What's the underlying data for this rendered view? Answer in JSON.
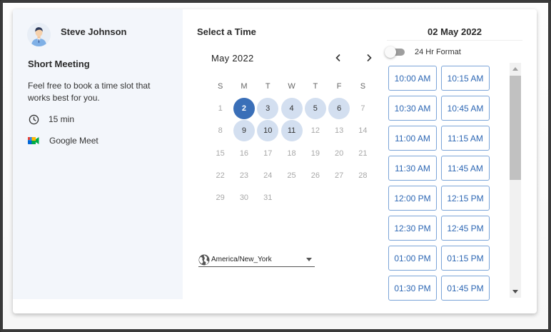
{
  "host": {
    "name": "Steve Johnson",
    "avatar_icon": "user-avatar-icon"
  },
  "event": {
    "title": "Short Meeting",
    "description": "Feel free to book a time slot that works best for you.",
    "duration": "15 min",
    "location": "Google Meet"
  },
  "calendar": {
    "section_title": "Select a Time",
    "month": "May",
    "year": "2022",
    "weekdays": [
      "S",
      "M",
      "T",
      "W",
      "T",
      "F",
      "S"
    ],
    "leading_blanks": 0,
    "days": [
      {
        "d": "1",
        "s": "off"
      },
      {
        "d": "2",
        "s": "selected"
      },
      {
        "d": "3",
        "s": "avail"
      },
      {
        "d": "4",
        "s": "avail"
      },
      {
        "d": "5",
        "s": "avail"
      },
      {
        "d": "6",
        "s": "avail"
      },
      {
        "d": "7",
        "s": "off"
      },
      {
        "d": "8",
        "s": "off"
      },
      {
        "d": "9",
        "s": "avail"
      },
      {
        "d": "10",
        "s": "avail"
      },
      {
        "d": "11",
        "s": "avail"
      },
      {
        "d": "12",
        "s": "off"
      },
      {
        "d": "13",
        "s": "off"
      },
      {
        "d": "14",
        "s": "off"
      },
      {
        "d": "15",
        "s": "off"
      },
      {
        "d": "16",
        "s": "off"
      },
      {
        "d": "17",
        "s": "off"
      },
      {
        "d": "18",
        "s": "off"
      },
      {
        "d": "19",
        "s": "off"
      },
      {
        "d": "20",
        "s": "off"
      },
      {
        "d": "21",
        "s": "off"
      },
      {
        "d": "22",
        "s": "off"
      },
      {
        "d": "23",
        "s": "off"
      },
      {
        "d": "24",
        "s": "off"
      },
      {
        "d": "25",
        "s": "off"
      },
      {
        "d": "26",
        "s": "off"
      },
      {
        "d": "27",
        "s": "off"
      },
      {
        "d": "28",
        "s": "off"
      },
      {
        "d": "29",
        "s": "off"
      },
      {
        "d": "30",
        "s": "off"
      },
      {
        "d": "31",
        "s": "off"
      }
    ],
    "timezone": "America/New_York"
  },
  "slots_panel": {
    "selected_date": "02 May 2022",
    "format_toggle_label": "24 Hr Format",
    "format_24h_on": false,
    "times": [
      "10:00 AM",
      "10:15 AM",
      "10:30 AM",
      "10:45 AM",
      "11:00 AM",
      "11:15 AM",
      "11:30 AM",
      "11:45 AM",
      "12:00 PM",
      "12:15 PM",
      "12:30 PM",
      "12:45 PM",
      "01:00 PM",
      "01:15 PM",
      "01:30 PM",
      "01:45 PM"
    ]
  },
  "colors": {
    "accent": "#3a6fb8",
    "available_day": "#d3dff0",
    "slot_border": "#7aa4d8",
    "slot_text": "#2d67b4",
    "left_panel_bg": "#f3f6fb"
  }
}
